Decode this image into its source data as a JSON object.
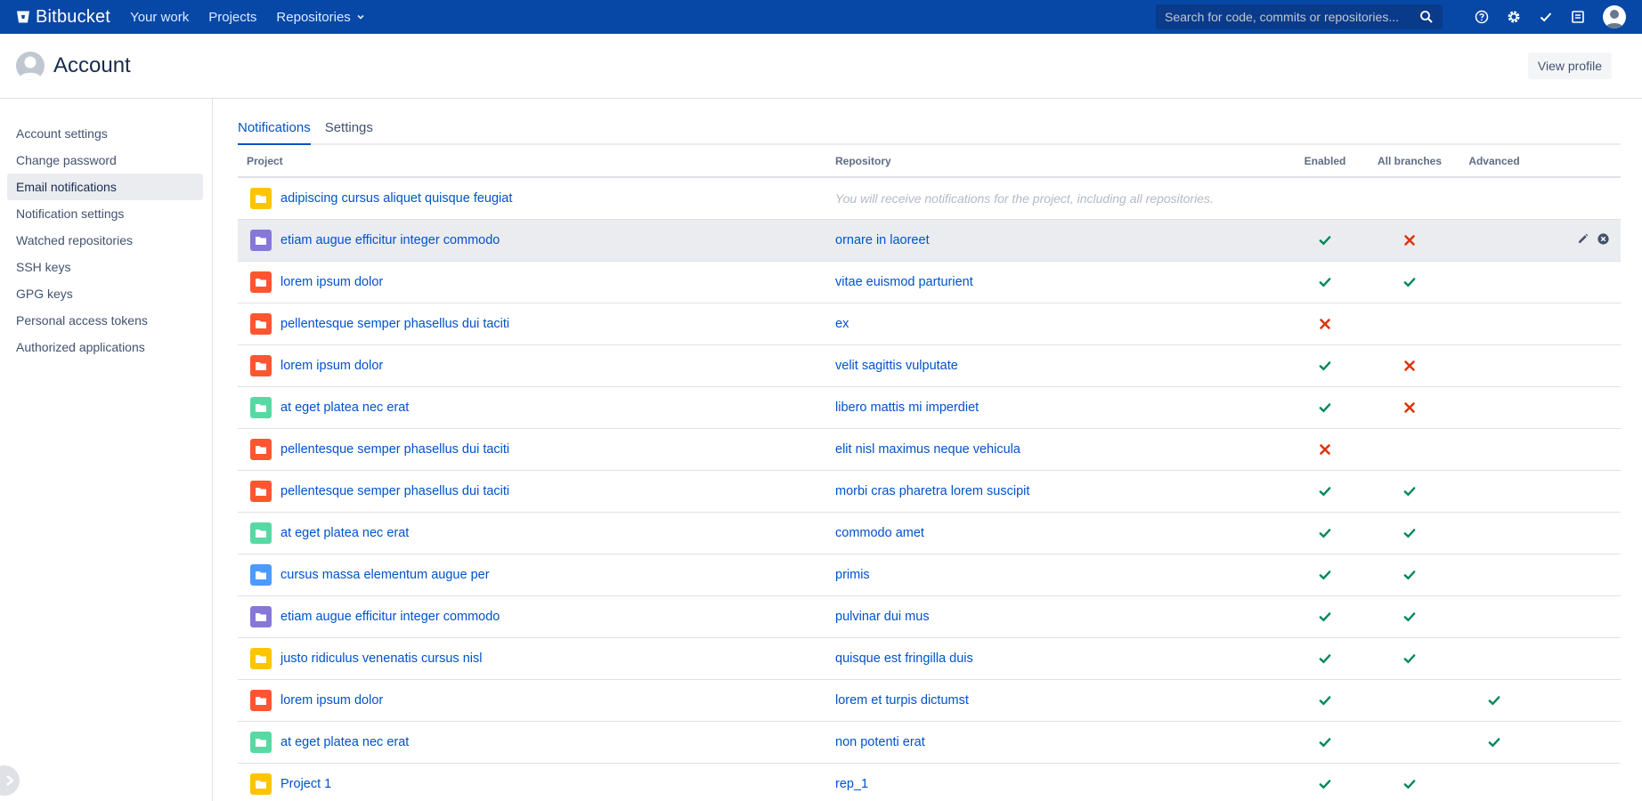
{
  "topnav": {
    "brand": "Bitbucket",
    "items": [
      {
        "label": "Your work"
      },
      {
        "label": "Projects"
      },
      {
        "label": "Repositories"
      }
    ],
    "search_placeholder": "Search for code, commits or repositories..."
  },
  "header": {
    "title": "Account",
    "view_profile": "View profile"
  },
  "sidebar": {
    "items": [
      {
        "label": "Account settings"
      },
      {
        "label": "Change password"
      },
      {
        "label": "Email notifications"
      },
      {
        "label": "Notification settings"
      },
      {
        "label": "Watched repositories"
      },
      {
        "label": "SSH keys"
      },
      {
        "label": "GPG keys"
      },
      {
        "label": "Personal access tokens"
      },
      {
        "label": "Authorized applications"
      }
    ]
  },
  "tabs": [
    {
      "label": "Notifications"
    },
    {
      "label": "Settings"
    }
  ],
  "table": {
    "headers": {
      "project": "Project",
      "repository": "Repository",
      "enabled": "Enabled",
      "all_branches": "All branches",
      "advanced": "Advanced"
    },
    "project_note": "You will receive notifications for the project, including all repositories.",
    "rows": [
      {
        "project": "adipiscing cursus aliquet quisque feugiat",
        "color": "#ffc400",
        "repo": "",
        "note": true,
        "enabled": "",
        "all": "",
        "adv": ""
      },
      {
        "project": "etiam augue efficitur integer commodo",
        "color": "#8777d9",
        "repo": "ornare in laoreet",
        "enabled": "check",
        "all": "cross",
        "adv": "",
        "hover": true
      },
      {
        "project": "lorem ipsum dolor",
        "color": "#ff5630",
        "repo": "vitae euismod parturient",
        "enabled": "check",
        "all": "check",
        "adv": ""
      },
      {
        "project": "pellentesque semper phasellus dui taciti",
        "color": "#ff5630",
        "repo": "ex",
        "enabled": "cross",
        "all": "",
        "adv": ""
      },
      {
        "project": "lorem ipsum dolor",
        "color": "#ff5630",
        "repo": "velit sagittis vulputate",
        "enabled": "check",
        "all": "cross",
        "adv": ""
      },
      {
        "project": "at eget platea nec erat",
        "color": "#57d9a3",
        "repo": "libero mattis mi imperdiet",
        "enabled": "check",
        "all": "cross",
        "adv": ""
      },
      {
        "project": "pellentesque semper phasellus dui taciti",
        "color": "#ff5630",
        "repo": "elit nisl maximus neque vehicula",
        "enabled": "cross",
        "all": "",
        "adv": ""
      },
      {
        "project": "pellentesque semper phasellus dui taciti",
        "color": "#ff5630",
        "repo": "morbi cras pharetra lorem suscipit",
        "enabled": "check",
        "all": "check",
        "adv": ""
      },
      {
        "project": "at eget platea nec erat",
        "color": "#57d9a3",
        "repo": "commodo amet",
        "enabled": "check",
        "all": "check",
        "adv": ""
      },
      {
        "project": "cursus massa elementum augue per",
        "color": "#4c9aff",
        "repo": "primis",
        "enabled": "check",
        "all": "check",
        "adv": ""
      },
      {
        "project": "etiam augue efficitur integer commodo",
        "color": "#8777d9",
        "repo": "pulvinar dui mus",
        "enabled": "check",
        "all": "check",
        "adv": ""
      },
      {
        "project": "justo ridiculus venenatis cursus nisl",
        "color": "#ffc400",
        "repo": "quisque est fringilla duis",
        "enabled": "check",
        "all": "check",
        "adv": ""
      },
      {
        "project": "lorem ipsum dolor",
        "color": "#ff5630",
        "repo": "lorem et turpis dictumst",
        "enabled": "check",
        "all": "",
        "adv": "check"
      },
      {
        "project": "at eget platea nec erat",
        "color": "#57d9a3",
        "repo": "non potenti erat",
        "enabled": "check",
        "all": "",
        "adv": "check"
      },
      {
        "project": "Project 1",
        "color": "#ffc400",
        "repo": "rep_1",
        "enabled": "check",
        "all": "check",
        "adv": ""
      }
    ]
  },
  "colors": {
    "nav": "#0747a6",
    "link": "#0052cc",
    "check": "#00875a",
    "cross": "#de350b"
  }
}
